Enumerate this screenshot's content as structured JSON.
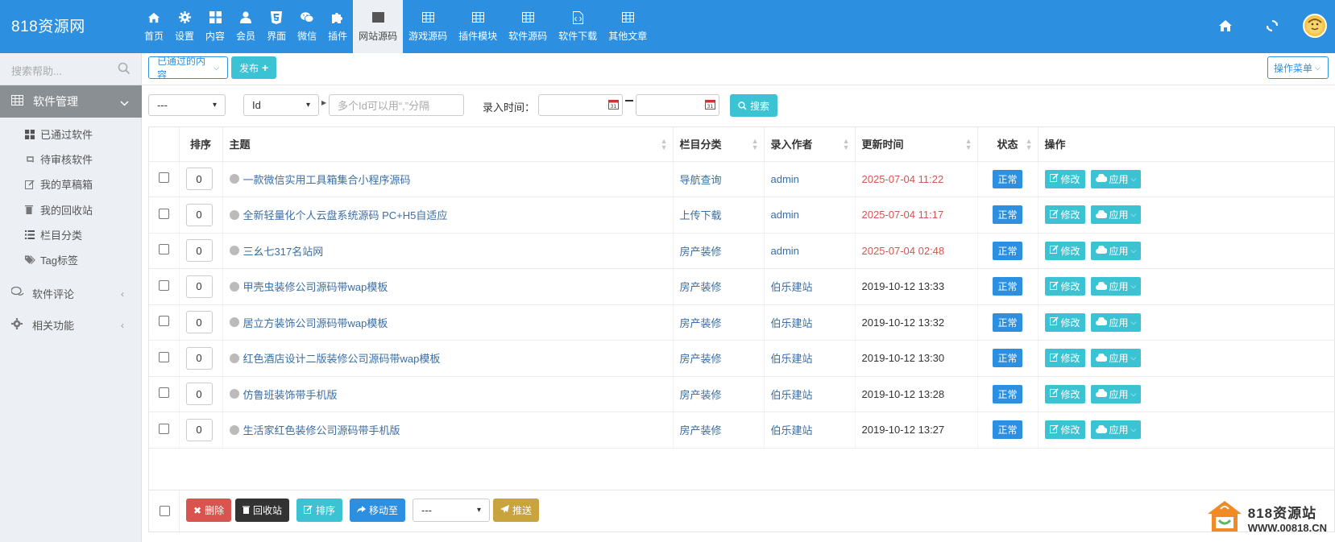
{
  "brand": "818资源网",
  "nav": [
    {
      "label": "首页",
      "icon": "home-icon"
    },
    {
      "label": "设置",
      "icon": "gear-icon"
    },
    {
      "label": "内容",
      "icon": "grid-icon"
    },
    {
      "label": "会员",
      "icon": "user-icon"
    },
    {
      "label": "界面",
      "icon": "html5-icon"
    },
    {
      "label": "微信",
      "icon": "wechat-icon"
    },
    {
      "label": "插件",
      "icon": "puzzle-icon"
    },
    {
      "label": "网站源码",
      "icon": "table-icon",
      "active": true
    },
    {
      "label": "游戏源码",
      "icon": "table-icon"
    },
    {
      "label": "插件模块",
      "icon": "table-icon"
    },
    {
      "label": "软件源码",
      "icon": "table-icon"
    },
    {
      "label": "软件下载",
      "icon": "file-code-icon"
    },
    {
      "label": "其他文章",
      "icon": "table-icon"
    }
  ],
  "sidebar": {
    "search_placeholder": "搜索帮助...",
    "section_title": "软件管理",
    "items": [
      {
        "label": "已通过软件",
        "icon": "grid-icon"
      },
      {
        "label": "待审核软件",
        "icon": "retweet-icon"
      },
      {
        "label": "我的草稿箱",
        "icon": "edit-icon"
      },
      {
        "label": "我的回收站",
        "icon": "trash-icon"
      },
      {
        "label": "栏目分类",
        "icon": "list-icon"
      },
      {
        "label": "Tag标签",
        "icon": "tags-icon"
      }
    ],
    "sections": [
      {
        "label": "软件评论",
        "icon": "comments-icon"
      },
      {
        "label": "相关功能",
        "icon": "cogs-icon"
      }
    ]
  },
  "toolbar": {
    "passed_label": "已通过的内容",
    "publish_label": "发布",
    "ops_menu_label": "操作菜单"
  },
  "filter": {
    "select1": "---",
    "field_select": "Id",
    "ids_placeholder": "多个Id可以用“,”分隔",
    "time_label": "录入时间：",
    "search_label": "搜索"
  },
  "table": {
    "headers": [
      "排序",
      "主题",
      "栏目分类",
      "录入作者",
      "更新时间",
      "状态",
      "操作"
    ],
    "edit_label": "修改",
    "apply_label": "应用",
    "rows": [
      {
        "order": "0",
        "title": "一款微信实用工具箱集合小程序源码",
        "category": "导航查询",
        "author": "admin",
        "time": "2025-07-04 11:22",
        "recent": true,
        "status": "正常"
      },
      {
        "order": "0",
        "title": "全新轻量化个人云盘系统源码 PC+H5自适应",
        "category": "上传下载",
        "author": "admin",
        "time": "2025-07-04 11:17",
        "recent": true,
        "status": "正常"
      },
      {
        "order": "0",
        "title": "三幺七317名站网",
        "category": "房产装修",
        "author": "admin",
        "time": "2025-07-04 02:48",
        "recent": true,
        "status": "正常"
      },
      {
        "order": "0",
        "title": "甲壳虫装修公司源码带wap模板",
        "category": "房产装修",
        "author": "伯乐建站",
        "time": "2019-10-12 13:33",
        "recent": false,
        "status": "正常"
      },
      {
        "order": "0",
        "title": "居立方装饰公司源码带wap模板",
        "category": "房产装修",
        "author": "伯乐建站",
        "time": "2019-10-12 13:32",
        "recent": false,
        "status": "正常"
      },
      {
        "order": "0",
        "title": "红色酒店设计二版装修公司源码带wap模板",
        "category": "房产装修",
        "author": "伯乐建站",
        "time": "2019-10-12 13:30",
        "recent": false,
        "status": "正常"
      },
      {
        "order": "0",
        "title": "仿鲁班装饰带手机版",
        "category": "房产装修",
        "author": "伯乐建站",
        "time": "2019-10-12 13:28",
        "recent": false,
        "status": "正常"
      },
      {
        "order": "0",
        "title": "生活家红色装修公司源码带手机版",
        "category": "房产装修",
        "author": "伯乐建站",
        "time": "2019-10-12 13:27",
        "recent": false,
        "status": "正常"
      }
    ]
  },
  "footer": {
    "delete_label": "删除",
    "recycle_label": "回收站",
    "sort_label": "排序",
    "move_label": "移动至",
    "move_select": "---",
    "push_label": "推送"
  },
  "watermark": {
    "line1": "818资源站",
    "line2": "WWW.00818.CN"
  },
  "colors": {
    "topbar": "#2d8fe0",
    "teal": "#3bc3d4",
    "red": "#d9534f",
    "dark": "#333333",
    "gold": "#c9a43e"
  }
}
